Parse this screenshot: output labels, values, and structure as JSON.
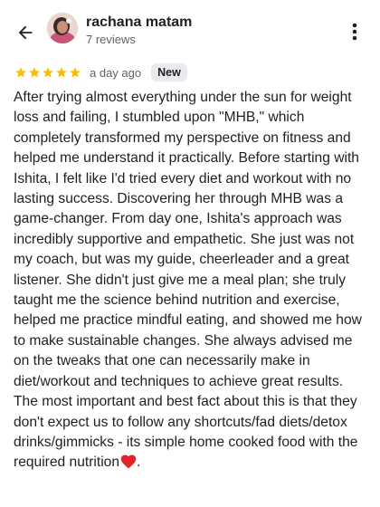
{
  "header": {
    "name": "rachana matam",
    "reviews_count": "7 reviews"
  },
  "review": {
    "rating": 5,
    "max_rating": 5,
    "date": "a day ago",
    "badge": "New",
    "text": "After trying almost everything under the sun for weight loss and failing, I stumbled upon \"MHB,\" which completely transformed my perspective on fitness and helped me understand it practically. Before starting with Ishita, I felt like I'd tried every diet and workout with no lasting success. Discovering her through MHB was a game-changer. From day one, Ishita's approach was incredibly supportive and empathetic. She just was not my coach, but was my guide, cheerleader and a great listener. She didn't just give me a meal plan; she truly taught me the science behind nutrition and exercise, helped me practice mindful eating, and showed me how to make sustainable changes. She always advised me on the tweaks that one can necessarily make in diet/workout and techniques to achieve great results. The most important and best fact about this is that they don't expect us to follow any shortcuts/fad diets/detox drinks/gimmicks - its simple home cooked food with the required nutrition",
    "text_end": "."
  },
  "icons": {
    "back": "arrow-left-icon",
    "more": "more-vertical-icon",
    "star": "star-icon",
    "heart": "heart-emoji-icon"
  },
  "colors": {
    "star": "#fbbc04",
    "heart": "#e0242c",
    "badge_bg": "#e8eaed"
  }
}
